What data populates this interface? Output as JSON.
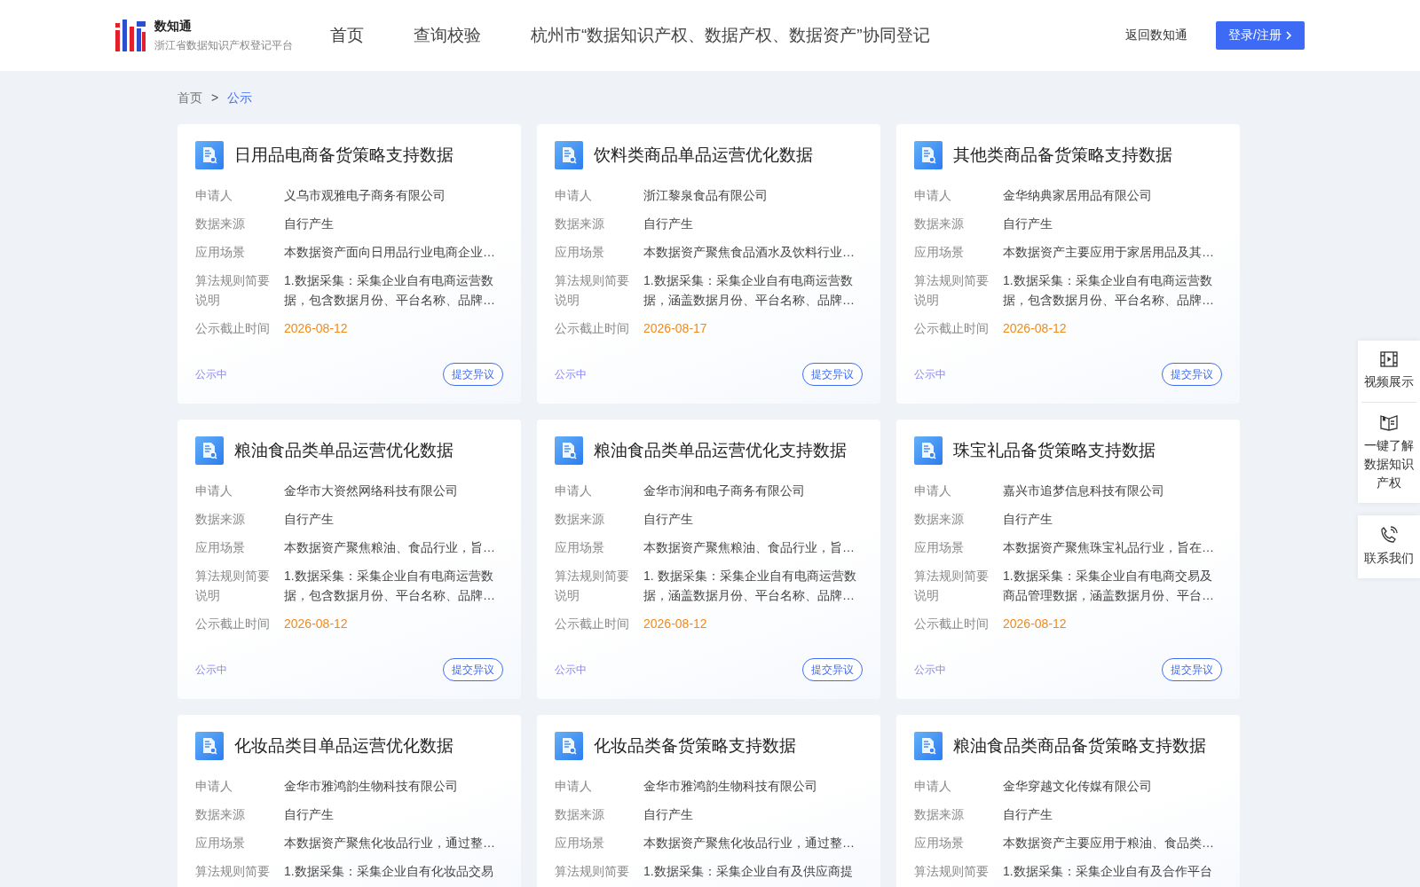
{
  "header": {
    "logo_title": "数知通",
    "logo_subtitle": "浙江省数据知识产权登记平台",
    "nav": [
      {
        "label": "首页",
        "selected": false
      },
      {
        "label": "查询校验",
        "selected": false
      },
      {
        "label": "杭州市“数据知识产权、数据产权、数据资产”协同登记",
        "selected": false
      }
    ],
    "back_link": "返回数知通",
    "login_button": "登录/注册"
  },
  "breadcrumb": [
    {
      "label": "首页",
      "kind": "link",
      "selected": false
    },
    {
      "label": ">",
      "kind": "separator"
    },
    {
      "label": "公示",
      "kind": "link",
      "selected": true
    }
  ],
  "cards": [
    {
      "title": "日用品电商备货策略支持数据",
      "fields": [
        {
          "label": "申请人",
          "value": "义乌市观雅电子商务有限公司"
        },
        {
          "label": "数据来源",
          "value": "自行产生"
        },
        {
          "label": "应用场景",
          "value": "本数据资产面向日用品行业电商企业…"
        },
        {
          "label": "算法规则简要说明",
          "value": "1.数据采集：采集企业自有电商运营数据，包含数据月份、平台名称、品牌…"
        },
        {
          "label": "公示截止时间",
          "value": "2026-08-12",
          "kind": "date"
        }
      ],
      "status": "公示中",
      "action": "提交异议"
    },
    {
      "title": "饮料类商品单品运营优化数据",
      "fields": [
        {
          "label": "申请人",
          "value": "浙江黎泉食品有限公司"
        },
        {
          "label": "数据来源",
          "value": "自行产生"
        },
        {
          "label": "应用场景",
          "value": "本数据资产聚焦食品酒水及饮料行业…"
        },
        {
          "label": "算法规则简要说明",
          "value": "1.数据采集：采集企业自有电商运营数据，涵盖数据月份、平台名称、品牌…"
        },
        {
          "label": "公示截止时间",
          "value": "2026-08-17",
          "kind": "date"
        }
      ],
      "status": "公示中",
      "action": "提交异议"
    },
    {
      "title": "其他类商品备货策略支持数据",
      "fields": [
        {
          "label": "申请人",
          "value": "金华纳典家居用品有限公司"
        },
        {
          "label": "数据来源",
          "value": "自行产生"
        },
        {
          "label": "应用场景",
          "value": "本数据资产主要应用于家居用品及其…"
        },
        {
          "label": "算法规则简要说明",
          "value": "1.数据采集：采集企业自有电商运营数据，包含数据月份、平台名称、品牌…"
        },
        {
          "label": "公示截止时间",
          "value": "2026-08-12",
          "kind": "date"
        }
      ],
      "status": "公示中",
      "action": "提交异议"
    },
    {
      "title": "粮油食品类单品运营优化数据",
      "fields": [
        {
          "label": "申请人",
          "value": "金华市大资然网络科技有限公司"
        },
        {
          "label": "数据来源",
          "value": "自行产生"
        },
        {
          "label": "应用场景",
          "value": "本数据资产聚焦粮油、食品行业，旨…"
        },
        {
          "label": "算法规则简要说明",
          "value": "1.数据采集：采集企业自有电商运营数据，包含数据月份、平台名称、品牌…"
        },
        {
          "label": "公示截止时间",
          "value": "2026-08-12",
          "kind": "date"
        }
      ],
      "status": "公示中",
      "action": "提交异议"
    },
    {
      "title": "粮油食品类单品运营优化支持数据",
      "fields": [
        {
          "label": "申请人",
          "value": "金华市润和电子商务有限公司"
        },
        {
          "label": "数据来源",
          "value": "自行产生"
        },
        {
          "label": "应用场景",
          "value": "本数据资产聚焦粮油、食品行业，旨…"
        },
        {
          "label": "算法规则简要说明",
          "value": "1. 数据采集：采集企业自有电商运营数据，涵盖数据月份、平台名称、品牌…"
        },
        {
          "label": "公示截止时间",
          "value": "2026-08-12",
          "kind": "date"
        }
      ],
      "status": "公示中",
      "action": "提交异议"
    },
    {
      "title": "珠宝礼品备货策略支持数据",
      "fields": [
        {
          "label": "申请人",
          "value": "嘉兴市追梦信息科技有限公司"
        },
        {
          "label": "数据来源",
          "value": "自行产生"
        },
        {
          "label": "应用场景",
          "value": "本数据资产聚焦珠宝礼品行业，旨在…"
        },
        {
          "label": "算法规则简要说明",
          "value": "1.数据采集：采集企业自有电商交易及商品管理数据，涵盖数据月份、平台…"
        },
        {
          "label": "公示截止时间",
          "value": "2026-08-12",
          "kind": "date"
        }
      ],
      "status": "公示中",
      "action": "提交异议"
    },
    {
      "title": "化妆品类目单品运营优化数据",
      "fields": [
        {
          "label": "申请人",
          "value": "金华市雅鸿韵生物科技有限公司"
        },
        {
          "label": "数据来源",
          "value": "自行产生"
        },
        {
          "label": "应用场景",
          "value": "本数据资产聚焦化妆品行业，通过整…"
        },
        {
          "label": "算法规则简要",
          "value": "1.数据采集：采集企业自有化妆品交易"
        }
      ]
    },
    {
      "title": "化妆品类备货策略支持数据",
      "fields": [
        {
          "label": "申请人",
          "value": "金华市雅鸿韵生物科技有限公司"
        },
        {
          "label": "数据来源",
          "value": "自行产生"
        },
        {
          "label": "应用场景",
          "value": "本数据资产聚焦化妆品行业，通过整…"
        },
        {
          "label": "算法规则简要",
          "value": "1.数据采集：采集企业自有及供应商提"
        }
      ]
    },
    {
      "title": "粮油食品类商品备货策略支持数据",
      "fields": [
        {
          "label": "申请人",
          "value": "金华穿越文化传媒有限公司"
        },
        {
          "label": "数据来源",
          "value": "自行产生"
        },
        {
          "label": "应用场景",
          "value": "本数据资产主要应用于粮油、食品类…"
        },
        {
          "label": "算法规则简要",
          "value": "1.数据采集：采集企业自有及合作平台"
        }
      ]
    }
  ],
  "side_panel": [
    {
      "label": "视频展示",
      "kind": "video"
    },
    {
      "label": "一键了解数据知识产权",
      "kind": "book"
    },
    {
      "label": "联系我们",
      "kind": "phone"
    }
  ]
}
